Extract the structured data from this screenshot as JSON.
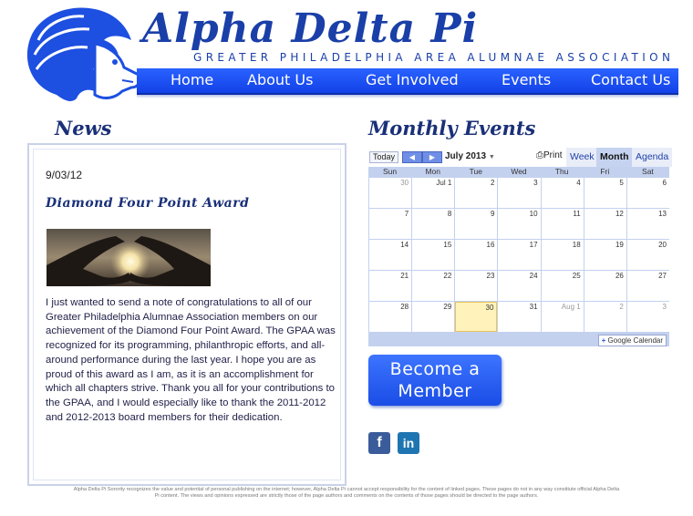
{
  "header": {
    "title": "Alpha Delta Pi",
    "subtitle": "GREATER PHILADELPHIA AREA ALUMNAE ASSOCIATION",
    "nav": [
      "Home",
      "About Us",
      "Get Involved",
      "Events",
      "Contact Us"
    ]
  },
  "news": {
    "heading": "News",
    "date": "9/03/12",
    "title": "Diamond Four Point Award",
    "body": "I just wanted to send a note of congratulations to all of our Greater Philadelphia Alumnae Association members on our achievement of the Diamond Four Point Award. The GPAA was recognized for its programming, philanthropic efforts, and all-around performance during the last year. I hope you are as proud of this award as I am, as it is an accomplishment for which all chapters strive. Thank you all for your contributions to the GPAA, and I would especially like to thank the 2011-2012 and 2012-2013 board members for their dedication."
  },
  "events": {
    "heading": "Monthly Events",
    "today_label": "Today",
    "month_label": "July 2013",
    "print_label": "Print",
    "tabs": [
      "Week",
      "Month",
      "Agenda"
    ],
    "active_tab": "Month",
    "weekdays": [
      "Sun",
      "Mon",
      "Tue",
      "Wed",
      "Thu",
      "Fri",
      "Sat"
    ],
    "weeks": [
      [
        "30",
        "Jul 1",
        "2",
        "3",
        "4",
        "5",
        "6"
      ],
      [
        "7",
        "8",
        "9",
        "10",
        "11",
        "12",
        "13"
      ],
      [
        "14",
        "15",
        "16",
        "17",
        "18",
        "19",
        "20"
      ],
      [
        "21",
        "22",
        "23",
        "24",
        "25",
        "26",
        "27"
      ],
      [
        "28",
        "29",
        "30",
        "31",
        "Aug 1",
        "2",
        "3"
      ]
    ],
    "other_month_cells": [
      "0-0",
      "4-4",
      "4-5",
      "4-6"
    ],
    "today_cell": "4-2",
    "gcal_label": "Google Calendar"
  },
  "member_button": {
    "line1": "Become a",
    "line2": "Member"
  },
  "social": {
    "facebook": "f",
    "linkedin": "in"
  },
  "disclaimer": "Alpha Delta Pi Sorority recognizes the value and potential of personal publishing on the internet; however, Alpha Delta Pi cannot accept responsibility for the content of linked pages. These pages do not in any way constitute official Alpha Delta Pi content. The views and opinions expressed are strictly those of the page authors and comments on the contents of those pages should be directed to the page authors.",
  "colors": {
    "brand": "#1a3fa8",
    "nav": "#1a4de6",
    "calendar_grid": "#c3d1ef",
    "today": "#fff2bb"
  }
}
